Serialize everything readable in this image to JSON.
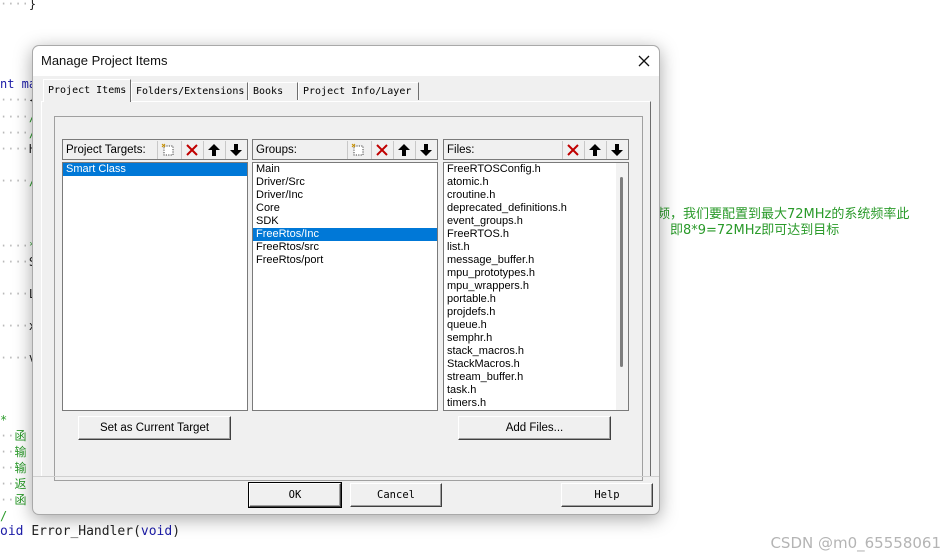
{
  "editor": {
    "lines": [
      {
        "indent": "····",
        "text": "}",
        "cls": ""
      },
      {
        "indent": "",
        "text": "nt ma",
        "cls": "kw"
      },
      {
        "indent": "····",
        "text": "{",
        "cls": ""
      },
      {
        "indent": "····",
        "text": "/",
        "cls": "cm"
      },
      {
        "indent": "····",
        "text": "/",
        "cls": "cm"
      },
      {
        "indent": "····",
        "text": "HA",
        "cls": ""
      },
      {
        "indent": "····",
        "text": "/",
        "cls": "cm"
      },
      {
        "indent": "····",
        "text": "*/",
        "cls": "cm"
      },
      {
        "indent": "····",
        "text": "Sy",
        "cls": ""
      },
      {
        "indent": "····",
        "text": "Le",
        "cls": ""
      },
      {
        "indent": "····",
        "text": "xT",
        "cls": ""
      },
      {
        "indent": "····",
        "text": "vT",
        "cls": ""
      },
      {
        "indent": "",
        "text": "*",
        "cls": "cm"
      },
      {
        "indent": "··",
        "text": "函",
        "cls": "cm"
      },
      {
        "indent": "··",
        "text": "输",
        "cls": "cm"
      },
      {
        "indent": "··",
        "text": "输",
        "cls": "cm"
      },
      {
        "indent": "··",
        "text": "返",
        "cls": "cm"
      },
      {
        "indent": "··",
        "text": "函",
        "cls": "cm"
      },
      {
        "indent": "",
        "text": "/",
        "cls": "cm"
      }
    ],
    "bottom_kw": "oid",
    "bottom_fn": "Error_Handler",
    "bottom_arg": "void",
    "comment_line1": "频，我们要配置到最大72MHz的系统频率此",
    "comment_line2": "即8*9=72MHz即可达到目标"
  },
  "watermark": "CSDN @m0_65558061",
  "dialog": {
    "title": "Manage Project Items",
    "tabs": [
      "Project Items",
      "Folders/Extensions",
      "Books",
      "Project Info/Layer"
    ],
    "targets": {
      "label": "Project Targets:",
      "items": [
        "Smart Class"
      ],
      "selected": 0
    },
    "groups": {
      "label": "Groups:",
      "items": [
        "Main",
        "Driver/Src",
        "Driver/Inc",
        "Core",
        "SDK",
        "FreeRtos/Inc",
        "FreeRtos/src",
        "FreeRtos/port"
      ],
      "selected": 5
    },
    "files": {
      "label": "Files:",
      "items": [
        "FreeRTOSConfig.h",
        "atomic.h",
        "croutine.h",
        "deprecated_definitions.h",
        "event_groups.h",
        "FreeRTOS.h",
        "list.h",
        "message_buffer.h",
        "mpu_prototypes.h",
        "mpu_wrappers.h",
        "portable.h",
        "projdefs.h",
        "queue.h",
        "semphr.h",
        "stack_macros.h",
        "StackMacros.h",
        "stream_buffer.h",
        "task.h",
        "timers.h"
      ]
    },
    "set_target_label": "Set as Current Target",
    "add_files_label": "Add Files...",
    "ok_label": "OK",
    "cancel_label": "Cancel",
    "help_label": "Help"
  },
  "colors": {
    "selection": "#0078d7",
    "delete_red": "#c00000",
    "comment_green": "#2a9a2a"
  }
}
